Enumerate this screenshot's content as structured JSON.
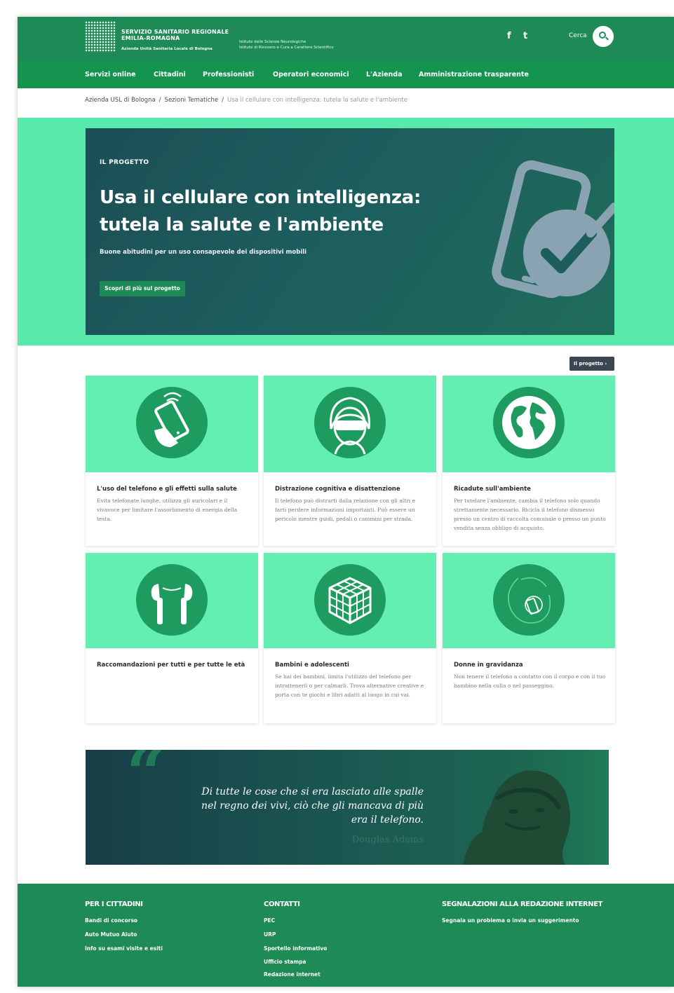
{
  "header": {
    "logo_title_line1": "SERVIZIO SANITARIO REGIONALE",
    "logo_title_line2": "EMILIA-ROMAGNA",
    "logo_subtitle": "Azienda Unità Sanitaria Locale di Bologna",
    "institute_line1": "Istituto delle Scienze Neurologiche",
    "institute_line2": "Istituto di Ricovero e Cura a Carattere Scientifico",
    "facebook": "f",
    "twitter": "t",
    "search_label": "Cerca"
  },
  "nav": {
    "items": [
      "Servizi online",
      "Cittadini",
      "Professionisti",
      "Operatori economici",
      "L'Azienda",
      "Amministrazione trasparente"
    ]
  },
  "breadcrumb": {
    "home": "Azienda USL di Bologna",
    "section": "Sezioni Tematiche",
    "current": "Usa il cellulare con intelligenza: tutela la salute e l'ambiente",
    "separator": "/"
  },
  "hero": {
    "kicker": "IL PROGETTO",
    "title_line1": "Usa il cellulare con intelligenza:",
    "title_line2": "tutela la salute e l'ambiente",
    "lead": "Buone abitudini per un uso consapevole dei dispositivi mobili",
    "cta": "Scopri di più sul progetto"
  },
  "tag_button": "Il progetto ›",
  "cards": [
    {
      "title": "L'uso del telefono e gli effetti sulla salute",
      "text": "Evita telefonate lunghe, utilizza gli auricolari e il vivavoce per limitare l'assorbimento di energia della testa.",
      "icon": "phone-hand-icon"
    },
    {
      "title": "Distrazione cognitiva e disattenzione",
      "text": "Il telefono può distrarti dalla relazione con gli altri e farti perdere informazioni importanti. Può essere un pericolo mentre guidi, pedali o cammini per strada.",
      "icon": "person-vr-icon"
    },
    {
      "title": "Ricadute sull'ambiente",
      "text": "Per tutelare l'ambiente, cambia il telefono solo quando strettamente necessario. Ricicla il telefono dismesso presso un centro di raccolta comunale o presso un punto vendita senza obbligo di acquisto.",
      "icon": "globe-icon"
    },
    {
      "title": "Raccomandazioni per tutti e per tutte le età",
      "text": "",
      "icon": "earphones-icon"
    },
    {
      "title": "Bambini e adolescenti",
      "text": "Se hai dei bambini, limita l'utilizzo del telefono per intrattenerli o per calmarli. Trova alternative creative e porta con te giochi e libri adatti al luogo in cui vai.",
      "icon": "rubik-cube-icon"
    },
    {
      "title": "Donne in gravidanza",
      "text": "Non tenere il telefono a contatto con il corpo e con il tuo bambino nella culla o nel passeggino.",
      "icon": "fetus-phone-icon"
    }
  ],
  "quote": {
    "mark": "“",
    "line1": "Di tutte le cose che si era lasciato alle spalle",
    "line2": "nel regno dei vivi, ciò che gli mancava di più",
    "line3": "era il telefono.",
    "author": "Douglas Adams"
  },
  "footer": {
    "col1": {
      "title": "PER I CITTADINI",
      "links": [
        "Bandi di concorso",
        "Auto Mutuo Aiuto",
        "Info su esami visite e esiti"
      ]
    },
    "col2": {
      "title": "CONTATTI",
      "links": [
        "PEC",
        "URP",
        "Sportello informativo",
        "Ufficio stampa",
        "Redazione internet"
      ]
    },
    "col3": {
      "title": "SEGNALAZIONI ALLA REDAZIONE INTERNET",
      "links": [
        "Segnala un problema o invia un suggerimento"
      ]
    }
  },
  "colors": {
    "brand_green": "#1e8a55",
    "mint": "#58eaaa",
    "hero_teal": "#1d5d5e"
  }
}
